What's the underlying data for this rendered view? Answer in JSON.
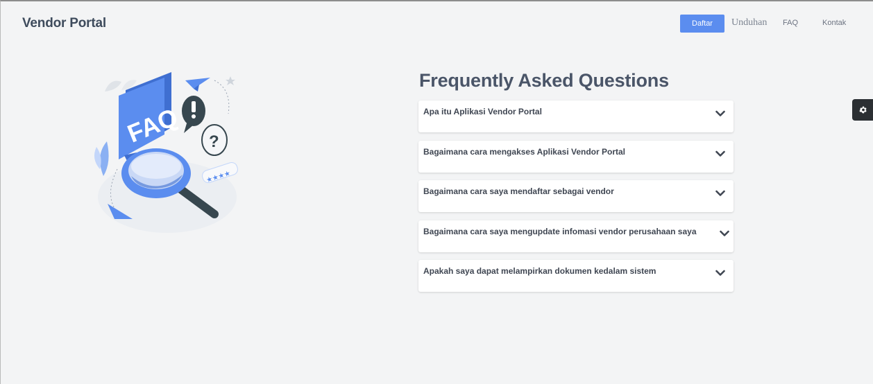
{
  "header": {
    "brand": "Vendor Portal",
    "nav": {
      "register_label": "Daftar",
      "downloads_label": "Unduhan",
      "faq_label": "FAQ",
      "contact_label": "Kontak"
    }
  },
  "faq": {
    "title": "Frequently Asked Questions",
    "items": [
      {
        "question": "Apa itu Aplikasi Vendor Portal"
      },
      {
        "question": "Bagaimana cara mengakses Aplikasi Vendor Portal"
      },
      {
        "question": "Bagaimana cara saya mendaftar sebagai vendor"
      },
      {
        "question": "Bagaimana cara saya mengupdate infomasi vendor perusahaan saya"
      },
      {
        "question": "Apakah saya dapat melampirkan dokumen kedalam sistem"
      }
    ]
  },
  "illustration": {
    "sign_text": "FAQ"
  },
  "icons": {
    "accordion_toggle": "chevron-down-icon",
    "settings": "gear-icon"
  },
  "colors": {
    "accent": "#5b8def",
    "background": "#f3f4f5",
    "title": "#4a5568",
    "settings_tab": "#2b2f33"
  }
}
